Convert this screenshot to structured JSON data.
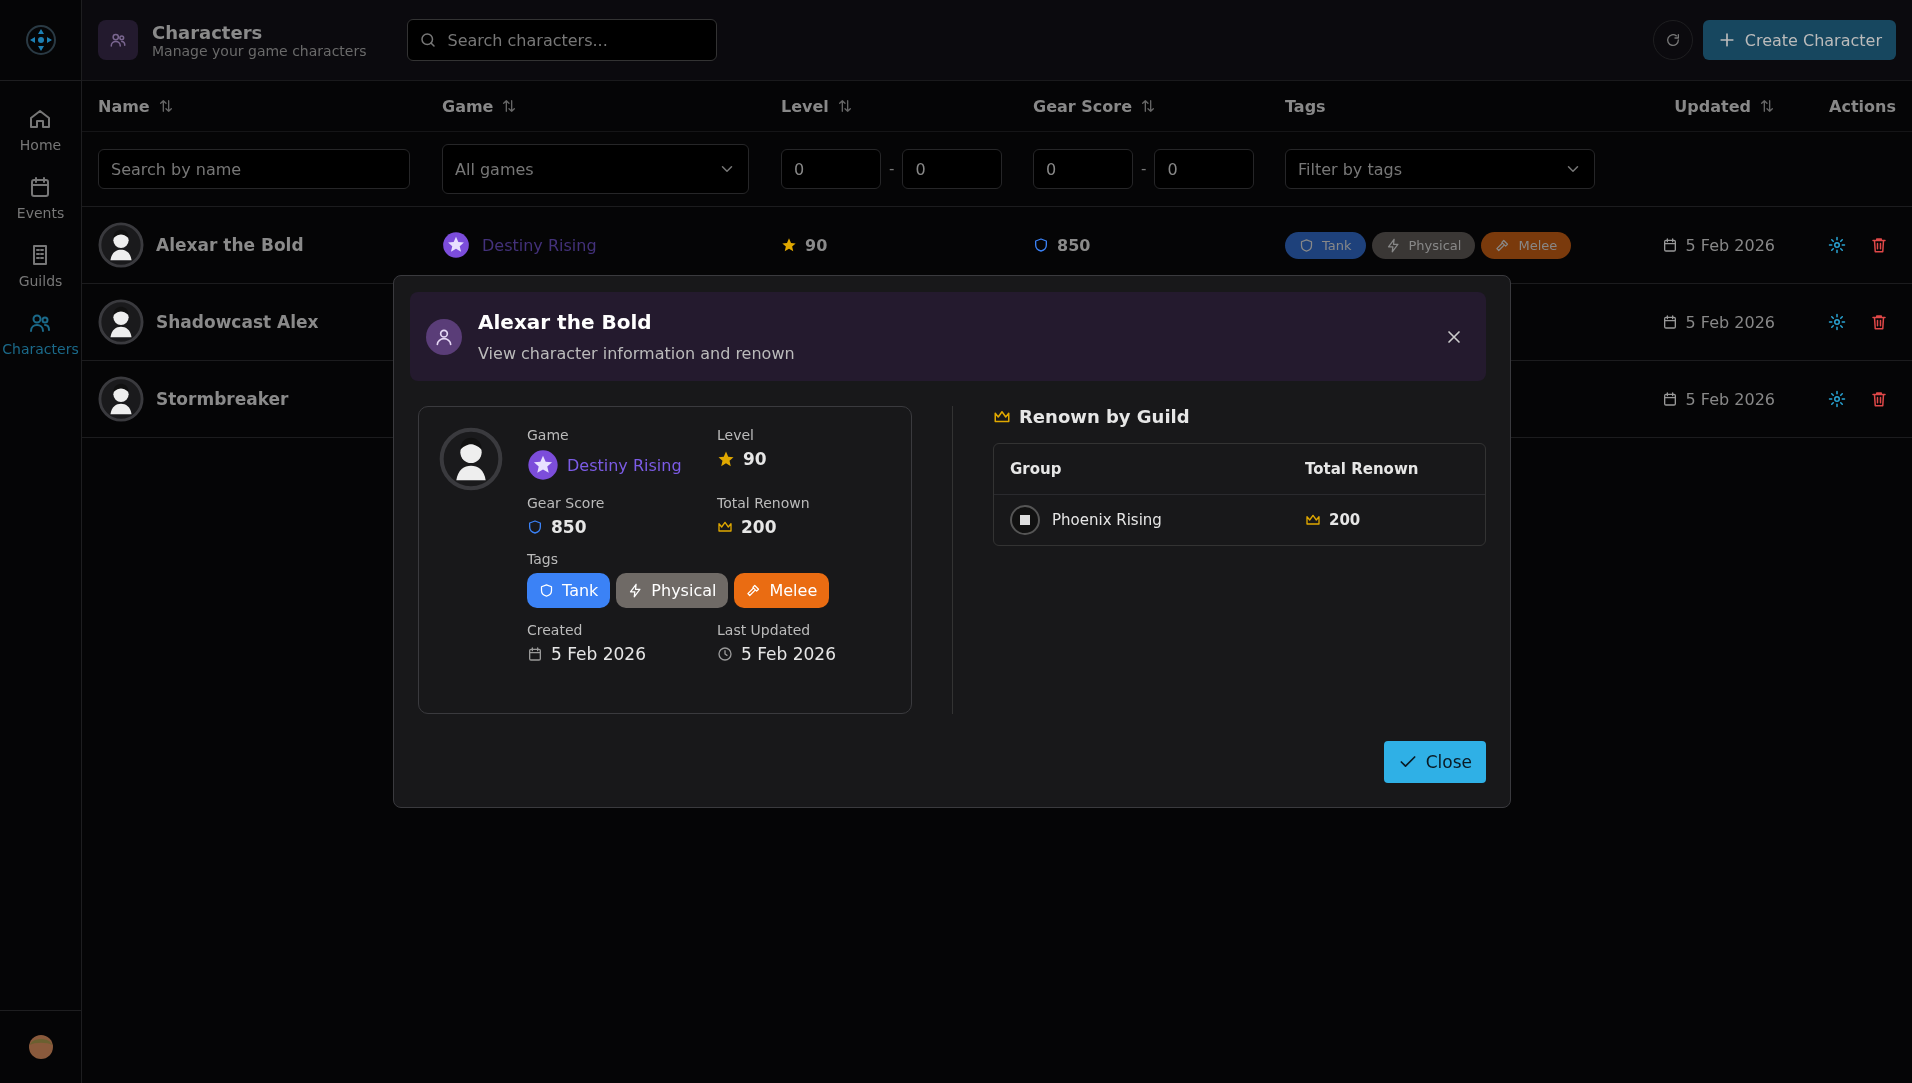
{
  "topbar": {
    "title": "Characters",
    "subtitle": "Manage your game characters",
    "search_placeholder": "Search characters...",
    "create_button": "Create Character"
  },
  "sidebar": {
    "items": [
      {
        "label": "Home",
        "kind": "home",
        "selected": false
      },
      {
        "label": "Events",
        "kind": "calendar",
        "selected": false
      },
      {
        "label": "Guilds",
        "kind": "building",
        "selected": false
      },
      {
        "label": "Characters",
        "kind": "people",
        "selected": true
      }
    ]
  },
  "table": {
    "columns": [
      {
        "label": "Name",
        "sortable": true
      },
      {
        "label": "Game",
        "sortable": true
      },
      {
        "label": "Level",
        "sortable": true
      },
      {
        "label": "Gear Score",
        "sortable": true
      },
      {
        "label": "Tags",
        "sortable": false
      },
      {
        "label": "Updated",
        "sortable": true
      },
      {
        "label": "Actions",
        "sortable": false
      }
    ],
    "filters": {
      "name_placeholder": "Search by name",
      "game": "All games",
      "level_min": "0",
      "level_separator": "-",
      "level_max": "0",
      "gear_min": "0",
      "gear_separator": "-",
      "gear_max": "0",
      "tags_placeholder": "Filter by tags"
    },
    "rows": [
      {
        "name": "Alexar the Bold",
        "game": "Destiny Rising",
        "level": "90",
        "gear_score": "850",
        "tags": [
          {
            "label": "Tank",
            "kind": "shield",
            "color": "#1e417b"
          },
          {
            "label": "Physical",
            "kind": "bolt",
            "color": "#3a3735"
          },
          {
            "label": "Melee",
            "kind": "hammer",
            "color": "#7a3a0c"
          }
        ],
        "updated": "5 Feb 2026"
      },
      {
        "name": "Shadowcast Alex",
        "updated": "5 Feb 2026"
      },
      {
        "name": "Stormbreaker",
        "updated": "5 Feb 2026"
      }
    ]
  },
  "dialog": {
    "title": "Alexar the Bold",
    "subtitle": "View character information and renown",
    "game_label": "Game",
    "game": "Destiny Rising",
    "level_label": "Level",
    "level": "90",
    "gear_label": "Gear Score",
    "gear_score": "850",
    "renown_label": "Total Renown",
    "renown": "200",
    "tags_label": "Tags",
    "tags": [
      {
        "label": "Tank",
        "kind": "shield",
        "color": "#3b82f6"
      },
      {
        "label": "Physical",
        "kind": "bolt",
        "color": "#6f6a66"
      },
      {
        "label": "Melee",
        "kind": "hammer",
        "color": "#ea6c12"
      }
    ],
    "created_label": "Created",
    "created": "5 Feb 2026",
    "updated_label": "Last Updated",
    "updated": "5 Feb 2026",
    "guild_heading": "Renown by Guild",
    "guild_columns": [
      "Group",
      "Total Renown"
    ],
    "guild_rows": [
      {
        "group": "Phoenix Rising",
        "renown": "200"
      }
    ],
    "close_button": "Close"
  }
}
